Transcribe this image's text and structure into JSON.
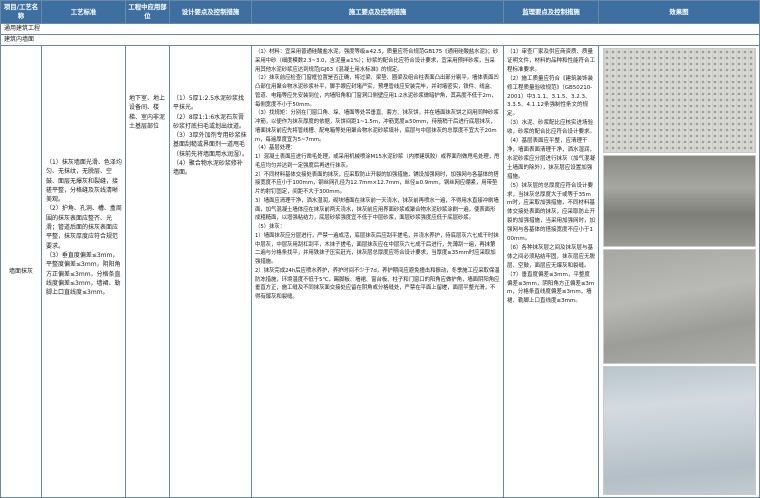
{
  "header": {
    "item": "项目/工艺名称",
    "standard": "工艺标准",
    "parts": "工程中应用部位",
    "design": "设计要点及控制措施",
    "construction": "施工要点及控制措施",
    "supervision": "监理要点及控制措施",
    "effect": "效果图"
  },
  "sections": {
    "general": "通用建筑工程",
    "interior": "建筑内墙面"
  },
  "row": {
    "name": "墙面抹灰",
    "standard": "（1）抹灰墙面光滑、色泽均匀、无抹纹，无脱层、空鼓、面层无爆灰和裂缝，接槎平整，分格缝及灰线清晰美观。\n（2）护角、孔洞、槽、盒周围的抹灰表面应整齐、光滑；管道后面的抹灰表面应平整，抹灰厚度应符合规范要求。\n（3）垂直度偏差≤3mm，平整度偏差≤3mm，阴阳角方正偏差≤3mm，分格条直线度偏差≤3mm，墙裙、勒脚上口直线度≤3mm。",
    "parts": "地下室、地上设备间、楼梯、室内非泥土基层部位",
    "design": "（1）5厚1:2.5水泥砂浆找平抹光。\n（2）8厚1:1:6水泥石灰膏砂浆打底扫毛或划出纹道。\n（3）3厚外加剂专用砂浆抹基面刮糙或界面剂一道甩毛（抹前先将墙面用水润湿）。\n（4）聚合物水泥砂浆修补墙面。",
    "construction": "（1）材料：宜采用普通硅酸盐水泥，强度等级≥42.5，质量应符合规范GB175《通用硅酸盐水泥》；砂采用中砂（细度模数2.3~3.0，含泥量≤1%）；砂浆的配合比应符合设计要求，宜采用预拌砂浆，当采用其他水泥砂浆应达到规范JGJ63《混凝土用水标准》的规定。\n（2）抹灰前应检查门窗框位置是否正确，将过梁、梁垫、圈梁及组合柱表面凸出部分剔平，墙体表面凹凸部位用聚合物水泥砂浆补平，脚手眼应封堵严实，预埋管线应安装完毕，并封堵密实，铁件、线盒、管道、电箱等应先安装到位，内墙阳角和门窗洞口侧壁应用1:2水泥砂浆做暗护角，其高度不低于2m，每侧宽度不小于50mm。\n（3）找规矩：分别在门窗口角、垛、墙面等处吊垂直、套方、抹灰饼，并在墙面抹灰饼之间用同种砂浆冲筋，以便作为抹灰厚度的依据，灰饼间距1~1.5m，冲筋宽度≥50mm，待筋稍干后进行底层抹灰，墙面抹灰前应先将管线槽、配电箱等处用聚合物水泥砂浆填补，底层与中层抹灰的总厚度不宜大于20mm，每遍厚度宜为5~7mm。\n（4）基层处理：\n1）混凝土表面应进行凿毛处理，或采用机械喷涂M15水泥砂浆（内掺建筑胶）或界面剂做甩毛处理，甩毛应均匀并达到一定强度后再进行抹灰。\n2）不同材料基体交接处表面的抹灰，应采取防止开裂的加强措施，铺设加强网时，加强网与各基体的搭接宽度不应小于100mm，钢丝网孔径为12.7mm×12.7mm，丝径≥0.9mm，钢丝网应绷紧，用带垫片的射钉固定，间距不大于300mm。\n3）墙面应清理干净，洒水湿润，砌块墙面在抹灰前一天浇水，抹灰前再喷水一遍，不得用水直接冲刷墙面，加气混凝土墙体应在抹灰前两天浇水，抹灰前应用界面砂浆或聚合物水泥砂浆涂刷一遍，使表面形成粗糙面，以增强粘结力，底层砂浆强度宜不低于中层砂浆，面层砂浆强度应低于底层砂浆。\n（5）抹灰：\n1）墙面抹灰应分层进行，严禁一遍成活，底层抹灰后应刮平搓毛，并浇水养护，待底层灰六七成干时抹中层灰，中层灰用刮杠刮平，木抹子搓毛，面层抹灰应在中层灰六七成干后进行，先薄刮一遍，再抹第二遍与分格条找平，并用铁抹子压实赶光，抹灰层总厚度应符合设计要求，当厚度≥35mm时应采取加强措施。\n2）抹灰完成24h后应喷水养护，养护时间不少于7d，养护期间应避免撞击和振动，冬季施工应采取保温防冻措施，环境温度不低于5℃，踢脚板、墙裙、窗台板、柱子和门窗口的阳角应做护角，墙面阴阳角应垂直方正，施工缝及不同抹灰面交接处应留在阴角或分格缝处，严禁在平面上留槎，面层平整光滑，不得有爆灰和裂缝。",
    "supervision": "（1）审查厂家及供应商资质、质量证明文件，材料的品种和性能符合工程标准要求。\n（2）施工质量应符合《建筑装饰装修工程质量验收规范》（GB50210-2001）中3.1.1、3.1.5、3.2.3、3.3.5、4.1.12条强制性条文的规定。\n（3）水泥、砂浆配比应核实进场验收，砂浆的配合比应符合设计要求。\n（4）基层表面应平整，应清理干净，墙面表面清理干净，洒水湿润，水泥砂浆应分层进行抹灰（加气混凝土墙面的除外），抹灰层应设置加强措施。\n（5）抹灰层的总厚度应符合设计要求，当抹灰总厚度大于或等于35mm时，应采取加强措施，不同材料基体交接处表面的抹灰，应采取防止开裂的加强措施，当采用加强网时，加强网与各基体的搭接宽度不应小于100mm。\n（6）各种抹灰层之间及抹灰层与基体之间必须粘结牢固，抹灰层应无脱层、空鼓，面层应无爆灰和裂缝。\n（7）垂直度偏差≤3mm，平整度偏差≤3mm，阴阳角方正偏差≤3mm，分格条直线度偏差≤3mm，墙裙、勒脚上口直线度≤3mm。"
  },
  "effects": [
    "wall-mesh-photo",
    "wall-plaster-photo",
    "wall-finish-photo",
    "wall-completed-photo"
  ]
}
